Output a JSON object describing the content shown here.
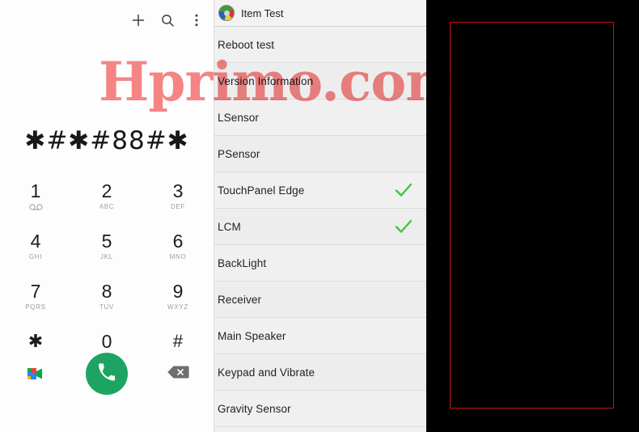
{
  "dialer": {
    "topbar": [
      {
        "name": "add-contact-icon",
        "label": "+"
      },
      {
        "name": "search-icon",
        "label": "search"
      },
      {
        "name": "overflow-menu-icon",
        "label": "more options"
      }
    ],
    "dialed_number": "✱#✱#88#✱",
    "keys": [
      {
        "digit": "1",
        "sub": "",
        "icon": "voicemail-icon"
      },
      {
        "digit": "2",
        "sub": "ABC",
        "icon": ""
      },
      {
        "digit": "3",
        "sub": "DEF",
        "icon": ""
      },
      {
        "digit": "4",
        "sub": "GHI",
        "icon": ""
      },
      {
        "digit": "5",
        "sub": "JKL",
        "icon": ""
      },
      {
        "digit": "6",
        "sub": "MNO",
        "icon": ""
      },
      {
        "digit": "7",
        "sub": "PQRS",
        "icon": ""
      },
      {
        "digit": "8",
        "sub": "TUV",
        "icon": ""
      },
      {
        "digit": "9",
        "sub": "WXYZ",
        "icon": ""
      },
      {
        "digit": "✱",
        "sub": "",
        "icon": ""
      },
      {
        "digit": "0",
        "sub": "+",
        "icon": ""
      },
      {
        "digit": "#",
        "sub": "",
        "icon": ""
      }
    ],
    "actions": {
      "video_call_label": "google-meet-icon",
      "call_label": "call-icon",
      "backspace_label": "backspace-icon",
      "call_button_color": "#1da462"
    }
  },
  "item_test": {
    "title": "Item Test",
    "app_icon": "color-wheel-icon",
    "rows": [
      {
        "label": "Reboot test",
        "checked": false
      },
      {
        "label": "Version Information",
        "checked": false
      },
      {
        "label": "LSensor",
        "checked": false
      },
      {
        "label": "PSensor",
        "checked": false
      },
      {
        "label": "TouchPanel Edge",
        "checked": true
      },
      {
        "label": "LCM",
        "checked": true
      },
      {
        "label": "BackLight",
        "checked": false
      },
      {
        "label": "Receiver",
        "checked": false
      },
      {
        "label": "Main Speaker",
        "checked": false
      },
      {
        "label": "Keypad and Vibrate",
        "checked": false
      },
      {
        "label": "Gravity Sensor",
        "checked": false
      }
    ],
    "check_color": "#3fc53f"
  },
  "black_panel": {
    "name": "lcm-test-screen",
    "background_color": "#000000",
    "rect_border_color": "#cc0f16"
  },
  "watermark": {
    "text": "Hprimo.com",
    "color": "#f23c3c"
  }
}
